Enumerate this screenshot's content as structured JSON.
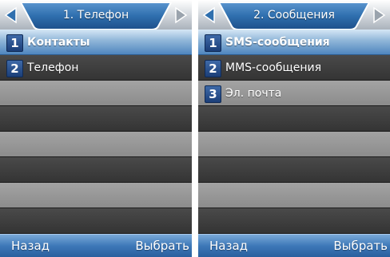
{
  "colors": {
    "header_tab": "#2f6fae",
    "selection": "#4f86bf",
    "number_badge": "#1b3e78",
    "softkey_bar": "#3d78b8"
  },
  "left": {
    "title": "1. Телефон",
    "items": [
      {
        "number": "1",
        "label": "Контакты",
        "selected": true
      },
      {
        "number": "2",
        "label": "Телефон",
        "selected": false
      }
    ],
    "softkeys": {
      "left": "Назад",
      "right": "Выбрать"
    }
  },
  "right": {
    "title": "2. Сообщения",
    "items": [
      {
        "number": "1",
        "label": "SMS-сообщения",
        "selected": true
      },
      {
        "number": "2",
        "label": "MMS-сообщения",
        "selected": false
      },
      {
        "number": "3",
        "label": "Эл. почта",
        "selected": false
      }
    ],
    "softkeys": {
      "left": "Назад",
      "right": "Выбрать"
    }
  },
  "icons": [
    "arrow-left-icon",
    "arrow-right-icon"
  ]
}
